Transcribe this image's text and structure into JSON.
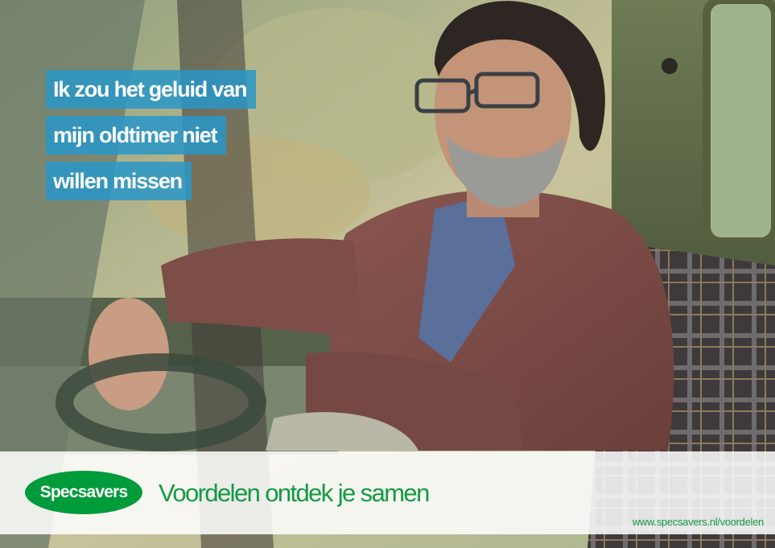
{
  "headline": {
    "lines": [
      "Ik zou het geluid van",
      "mijn oldtimer niet",
      "willen missen"
    ],
    "background_color": "#2896c8"
  },
  "brand": {
    "logo_text": "Specsavers",
    "color": "#009b3a"
  },
  "footer": {
    "tagline": "Voordelen ontdek je samen",
    "url": "www.specsavers.nl/voordelen"
  },
  "photo": {
    "subject": "bearded man in glasses and brown blazer sitting in vintage car"
  }
}
